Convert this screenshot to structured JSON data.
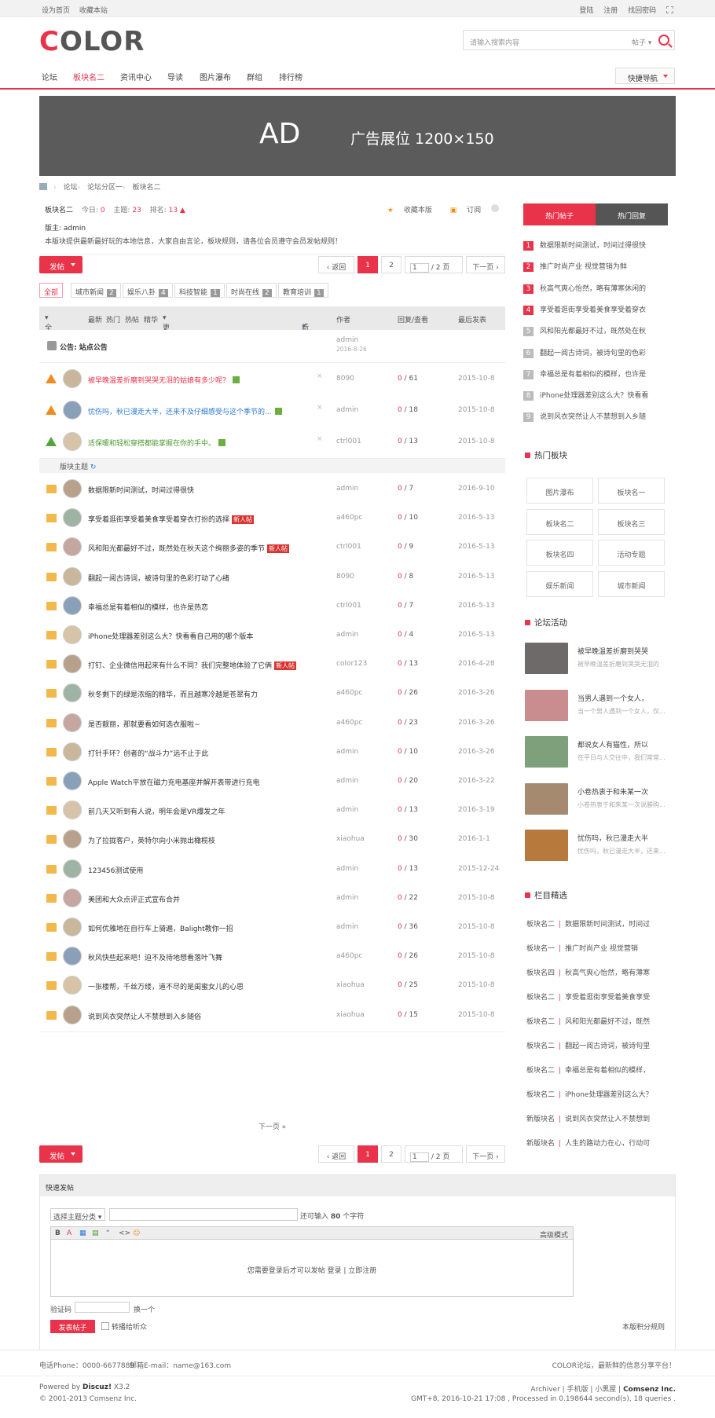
{
  "topbar": {
    "set_home": "设为首页",
    "favorite": "收藏本站",
    "login": "登陆",
    "register": "注册",
    "forgot": "找回密码"
  },
  "logo": {
    "part1": "C",
    "part2": "OLOR"
  },
  "search": {
    "placeholder": "请输入搜索内容",
    "type": "帖子"
  },
  "nav": {
    "items": [
      "论坛",
      "板块名二",
      "资讯中心",
      "导读",
      "图片瀑布",
      "群组",
      "排行榜"
    ],
    "quick": "快捷导航"
  },
  "ad": {
    "big": "AD",
    "small": "广告展位  1200×150"
  },
  "breadcrumb": [
    "论坛",
    "论坛分区一",
    "板块名二"
  ],
  "forum": {
    "name": "板块名二",
    "today_label": "今日:",
    "today": "0",
    "topic_label": "主题:",
    "topics": "23",
    "rank_label": "排名:",
    "rank": "13",
    "admin": "版主: admin",
    "desc": "本版块提供最新最好玩的本地信息，大家自由言论，板块规则，请各位会员遵守会员发帖规则！",
    "fav": "收藏本版",
    "rss": "订阅"
  },
  "post_btn": "发帖",
  "pager": {
    "back": "返回",
    "p1": "1",
    "p2": "2",
    "input": "1",
    "total": "/ 2 页",
    "next": "下一页"
  },
  "types": [
    {
      "label": "全部",
      "n": ""
    },
    {
      "label": "城市新闻",
      "n": "2"
    },
    {
      "label": "娱乐八卦",
      "n": "4"
    },
    {
      "label": "科技智能",
      "n": "1"
    },
    {
      "label": "时尚在线",
      "n": "2"
    },
    {
      "label": "教育培训",
      "n": "1"
    }
  ],
  "thead": {
    "all": "全部主题",
    "latest": "最新",
    "hot": "热门",
    "hotpost": "热帖",
    "digest": "精华",
    "more": "更多",
    "newwin": "新窗",
    "author": "作者",
    "replies": "回复/查看",
    "last": "最后发表"
  },
  "announce": {
    "title": "公告: 站点公告",
    "author": "admin",
    "date": "2016-8-26"
  },
  "sticky": [
    {
      "title": "被早晚温差折磨到哭哭无泪的姑娘有多少呢？",
      "author": "8090",
      "r": "0",
      "v": "61",
      "date": "2015-10-8",
      "style": "hl",
      "icon": "up"
    },
    {
      "title": "忧伤吗，秋已漫走大半，还来不及仔细感受与这个季节的...",
      "author": "admin",
      "r": "0",
      "v": "18",
      "date": "2015-10-8",
      "style": "bl",
      "icon": "up"
    },
    {
      "title": "适保暖和轻松穿搭都能掌握在你的手中。",
      "author": "ctrl001",
      "r": "0",
      "v": "13",
      "date": "2015-10-8",
      "style": "gr",
      "icon": "upg"
    }
  ],
  "section_label": "版块主题",
  "threads": [
    {
      "title": "数据限新时间测试，时间过得很快",
      "tag": "",
      "author": "admin",
      "r": "0",
      "v": "7",
      "date": "2016-9-10"
    },
    {
      "title": "享受着逛街享受着美食享受着穿衣打扮的选择",
      "tag": "新人帖",
      "author": "a460pc",
      "r": "0",
      "v": "10",
      "date": "2016-5-13"
    },
    {
      "title": "风和阳光都最好不过，既然处在秋天这个绚丽多姿的季节",
      "tag": "新人帖",
      "author": "ctrl001",
      "r": "0",
      "v": "9",
      "date": "2016-5-13"
    },
    {
      "title": "翻起一阅古诗词，被诗句里的色彩打动了心绪",
      "tag": "",
      "author": "8090",
      "r": "0",
      "v": "8",
      "date": "2016-5-13"
    },
    {
      "title": "幸福总是有着相似的模样，也许是热恋",
      "tag": "",
      "author": "ctrl001",
      "r": "0",
      "v": "7",
      "date": "2016-5-13"
    },
    {
      "title": "iPhone处理器差别这么大？快看看自己用的哪个版本",
      "tag": "",
      "author": "admin",
      "r": "0",
      "v": "4",
      "date": "2016-5-13"
    },
    {
      "title": "打钉、企业微信用起来有什么不同？我们完整地体验了它俩",
      "tag": "新人帖",
      "author": "color123",
      "r": "0",
      "v": "13",
      "date": "2016-4-28"
    },
    {
      "title": "秋冬剩下的绿是浓缩的精华，而且越寒冷越是苍翠有力",
      "tag": "",
      "author": "a460pc",
      "r": "0",
      "v": "26",
      "date": "2016-3-26"
    },
    {
      "title": "是否靓丽，那就要看如何选衣服啦~",
      "tag": "",
      "author": "a460pc",
      "r": "0",
      "v": "23",
      "date": "2016-3-26"
    },
    {
      "title": "打针手环？创者的“战斗力”远不止于此",
      "tag": "",
      "author": "admin",
      "r": "0",
      "v": "10",
      "date": "2016-3-26"
    },
    {
      "title": "Apple Watch平放在磁力充电基座并解开表带进行充电",
      "tag": "",
      "author": "admin",
      "r": "0",
      "v": "20",
      "date": "2016-3-22"
    },
    {
      "title": "前几天又听到有人说，明年会是VR爆发之年",
      "tag": "",
      "author": "admin",
      "r": "0",
      "v": "13",
      "date": "2016-3-19"
    },
    {
      "title": "为了拉拢客户，英特尔向小米抛出橄榄枝",
      "tag": "",
      "author": "xiaohua",
      "r": "0",
      "v": "30",
      "date": "2016-1-1"
    },
    {
      "title": "123456测试使用",
      "tag": "",
      "author": "admin",
      "r": "0",
      "v": "13",
      "date": "2015-12-24"
    },
    {
      "title": "美团和大众点评正式宣布合并",
      "tag": "",
      "author": "admin",
      "r": "0",
      "v": "22",
      "date": "2015-10-8"
    },
    {
      "title": "如何优雅地在自行车上骑遍，Balight教你一招",
      "tag": "",
      "author": "admin",
      "r": "0",
      "v": "36",
      "date": "2015-10-8"
    },
    {
      "title": "秋风快些起来吧！迫不及待地想看落叶飞舞",
      "tag": "",
      "author": "a460pc",
      "r": "0",
      "v": "26",
      "date": "2015-10-8"
    },
    {
      "title": "一张楼帮，千丝万缕，道不尽的是闺蜜女儿的心思",
      "tag": "",
      "author": "xiaohua",
      "r": "0",
      "v": "25",
      "date": "2015-10-8"
    },
    {
      "title": "说到风衣突然让人不禁想到入乡随俗",
      "tag": "",
      "author": "xiaohua",
      "r": "0",
      "v": "15",
      "date": "2015-10-8"
    }
  ],
  "more": "下一页 »",
  "side": {
    "tab_hot": "热门帖子",
    "tab_reply": "热门回复",
    "hot": [
      "数据限新时间测试，时间过得很快",
      "推广时尚产业 视觉营销为鲜",
      "秋高气爽心怡然，略有薄寒休闲的",
      "享受着逛街享受着美食享受着穿衣",
      "风和阳光都最好不过，既然处在秋",
      "翻起一阅古诗词，被诗句里的色彩",
      "幸福总是有着相似的模样，也许是",
      "iPhone处理器差别这么大？快看看",
      "说到风衣突然让人不禁想到入乡随"
    ],
    "hot_forum_title": "热门板块",
    "forums": [
      "图片瀑布",
      "板块名一",
      "板块名二",
      "板块名三",
      "板块名四",
      "活动专题",
      "娱乐新闻",
      "城市新闻"
    ],
    "activity_title": "论坛活动",
    "activities": [
      {
        "t1": "被早晚温差折磨到哭哭",
        "t2": "被早晚温差折磨到哭哭无泪的"
      },
      {
        "t1": "当男人遇到一个女人，",
        "t2": "当一个男人遇到一个女人，仅..."
      },
      {
        "t1": "都说女人有猫性，所以",
        "t2": "在平日与人交往中，我们常常..."
      },
      {
        "t1": "小卷热衷于和朱某一次",
        "t2": "小卷热衷于和朱某一次说勝购..."
      },
      {
        "t1": "忧伤吗，秋已漫走大半",
        "t2": "忧伤吗，秋已漫走大半，还来..."
      }
    ],
    "pick_title": "栏目精选",
    "picks": [
      {
        "f": "板块名二",
        "t": "数据限新时间测试，时间过"
      },
      {
        "f": "板块名一",
        "t": "推广时尚产业 视觉营销"
      },
      {
        "f": "板块名四",
        "t": "秋高气爽心怡然，略有薄寒"
      },
      {
        "f": "板块名二",
        "t": "享受着逛街享受着美食享受"
      },
      {
        "f": "板块名二",
        "t": "风和阳光都最好不过，既然"
      },
      {
        "f": "板块名二",
        "t": "翻起一阅古诗词，被诗句里"
      },
      {
        "f": "板块名二",
        "t": "幸福总是有着相似的模样，"
      },
      {
        "f": "板块名二",
        "t": "iPhone处理器差别这么大？"
      },
      {
        "f": "新版块名",
        "t": "说到风衣突然让人不禁想到"
      },
      {
        "f": "新版块名",
        "t": "人生的路动力在心，行动可"
      }
    ]
  },
  "quickpost": {
    "title": "快速发帖",
    "select": "选择主题分类",
    "count_pre": "还可输入",
    "count": "80",
    "count_post": "个字符",
    "toolbar": [
      "B",
      "A",
      "▦",
      "▤",
      "“",
      "<>",
      "☺"
    ],
    "advanced": "高级模式",
    "msg": "您需要登录后才可以发帖 登录 | 立即注册",
    "captcha": "验证码",
    "swap": "换一个",
    "send": "发表帖子",
    "broadcast": "转播给听众",
    "rules": "本版积分规则"
  },
  "footer": {
    "phone": "电话Phone：0000-6677889",
    "email": "邮箱E-mail：name@163.com",
    "slogan": "COLOR论坛，最新鲜的信息分享平台！",
    "powered_pre": "Powered by",
    "powered": "Discuz!",
    "version": "X3.2",
    "copy": "© 2001-2013 Comsenz Inc.",
    "links": "Archiver | 手机版 | 小黑屋 |",
    "company": "Comsenz Inc.",
    "time": "GMT+8, 2016-10-21 17:08 , Processed in 0.198644 second(s), 18 queries ."
  },
  "colors": {
    "accent": "#e8334a",
    "ad_bg": "#5b5b5b",
    "dark_tab": "#555555"
  }
}
